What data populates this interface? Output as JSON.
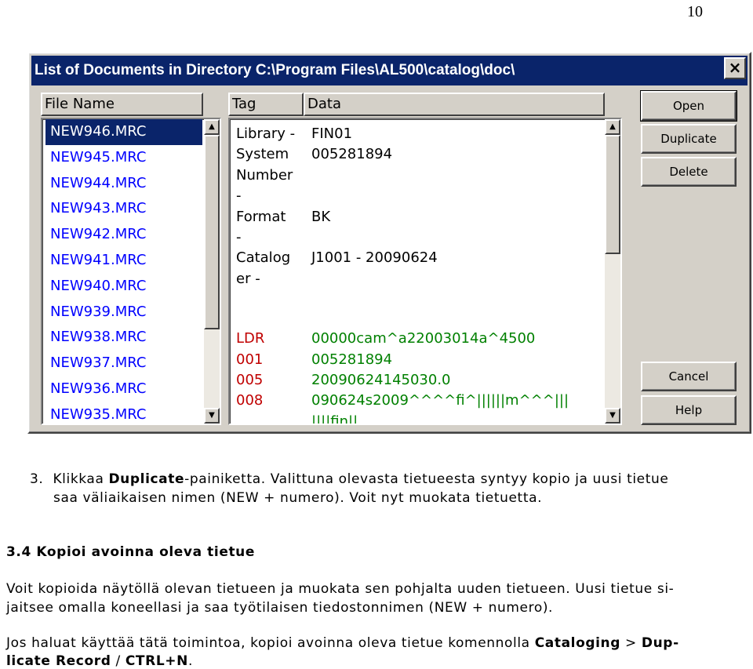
{
  "page_number": "10",
  "dialog": {
    "title": "List of Documents in Directory C:\\Program Files\\AL500\\catalog\\doc\\",
    "close_glyph": "×",
    "headers": {
      "file_name": "File Name",
      "tag": "Tag",
      "data": "Data"
    },
    "files": [
      "NEW946.MRC",
      "NEW945.MRC",
      "NEW944.MRC",
      "NEW943.MRC",
      "NEW942.MRC",
      "NEW941.MRC",
      "NEW940.MRC",
      "NEW939.MRC",
      "NEW938.MRC",
      "NEW937.MRC",
      "NEW936.MRC",
      "NEW935.MRC"
    ],
    "selected_file": "NEW946.MRC",
    "meta_rows": [
      {
        "tag": "Library -",
        "data": "FIN01"
      },
      {
        "tag": "System",
        "data": "005281894"
      },
      {
        "tag": "Number",
        "data": ""
      },
      {
        "tag": "-",
        "data": ""
      },
      {
        "tag": "Format",
        "data": "BK"
      },
      {
        "tag": "-",
        "data": ""
      },
      {
        "tag": "Catalog",
        "data": "J1001 - 20090624"
      },
      {
        "tag": "er -",
        "data": ""
      }
    ],
    "field_rows": [
      {
        "tag": "LDR",
        "data": "00000cam^a22003014a^4500"
      },
      {
        "tag": "001",
        "data": "005281894"
      },
      {
        "tag": "005",
        "data": "20090624145030.0"
      },
      {
        "tag": "008",
        "data": "090624s2009^^^^fi^||||||m^^^|||"
      },
      {
        "tag": "",
        "data": "||||fin||"
      }
    ],
    "buttons": {
      "open": "Open",
      "duplicate": "Duplicate",
      "delete": "Delete",
      "cancel": "Cancel",
      "help": "Help"
    },
    "scroll_up": "▲",
    "scroll_down": "▼"
  },
  "step3": {
    "number": "3.",
    "pre": "Klikkaa ",
    "bold": "Duplicate",
    "post": "-painiketta. Valittuna olevasta tietueesta syntyy kopio ja uusi tietue",
    "line2": "saa väliaikaisen nimen (NEW + numero). Voit nyt muokata tietuetta."
  },
  "section": {
    "heading": "3.4 Kopioi avoinna oleva tietue"
  },
  "para1": {
    "line1": "Voit kopioida näytöllä olevan tietueen ja muokata sen pohjalta uuden tietueen. Uusi tietue si-",
    "line2": "jaitsee omalla koneellasi ja saa työtilaisen tiedostonnimen (NEW + numero)."
  },
  "para2": {
    "pre": "Jos haluat käyttää tätä toimintoa, kopioi avoinna oleva tietue komennolla ",
    "b1": "Cataloging",
    "mid": " > ",
    "b2": "Dup-",
    "b3": "licate Record",
    "sep": " / ",
    "b4": "CTRL+N",
    "end": "."
  }
}
